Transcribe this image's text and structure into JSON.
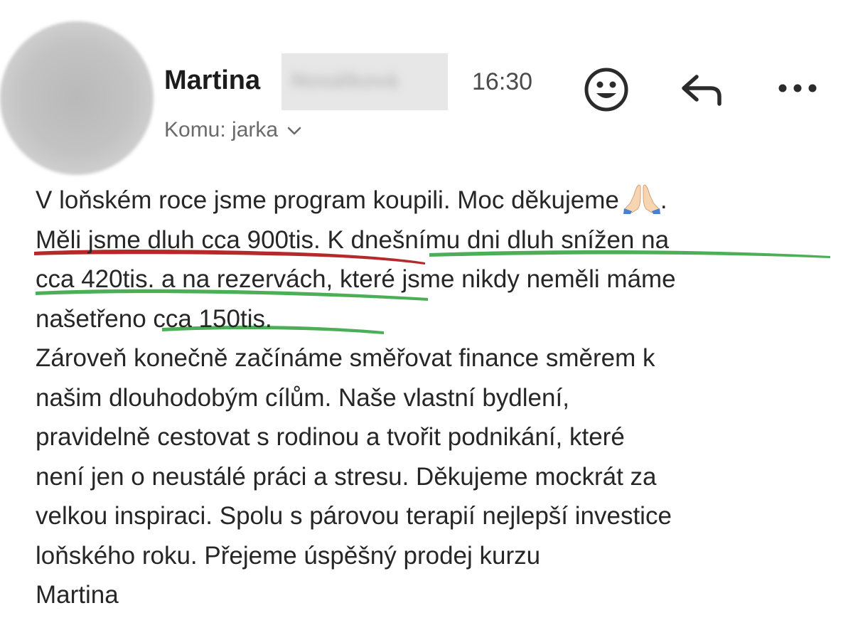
{
  "message": {
    "sender_first_name": "Martina",
    "sender_surname_redacted": "Nosálková",
    "time": "16:30",
    "recipient_label": "Komu: jarka",
    "icons": {
      "avatar": "blurred-avatar",
      "emoji": "emoji-reaction-icon",
      "reply": "reply-icon",
      "more": "more-options-icon",
      "chevron": "chevron-down-icon",
      "pray": "folded-hands-emoji"
    },
    "body_lines": [
      "V loňském roce jsme program koupili. Moc děkujeme",
      "Měli jsme dluh cca 900tis. K dnešnímu dni dluh snížen na",
      "cca 420tis. a na rezervách, které jsme nikdy neměli máme",
      "našetřeno cca 150tis.",
      "Zároveň konečně začínáme směřovat finance směrem k",
      "našim dlouhodobým cílům. Naše vlastní bydlení,",
      "pravidelně cestovat s rodinou a tvořit podnikání, které",
      "není jen o neustálé práci a stresu. Děkujeme mockrát za",
      "velkou inspiraci. Spolu s párovou terapií nejlepší investice",
      "loňského roku. Přejeme úspěšný prodej kurzu",
      "Martina"
    ],
    "body_line1_end": ".",
    "highlight_colors": {
      "red": "#b5292b",
      "green": "#4caf57"
    }
  }
}
